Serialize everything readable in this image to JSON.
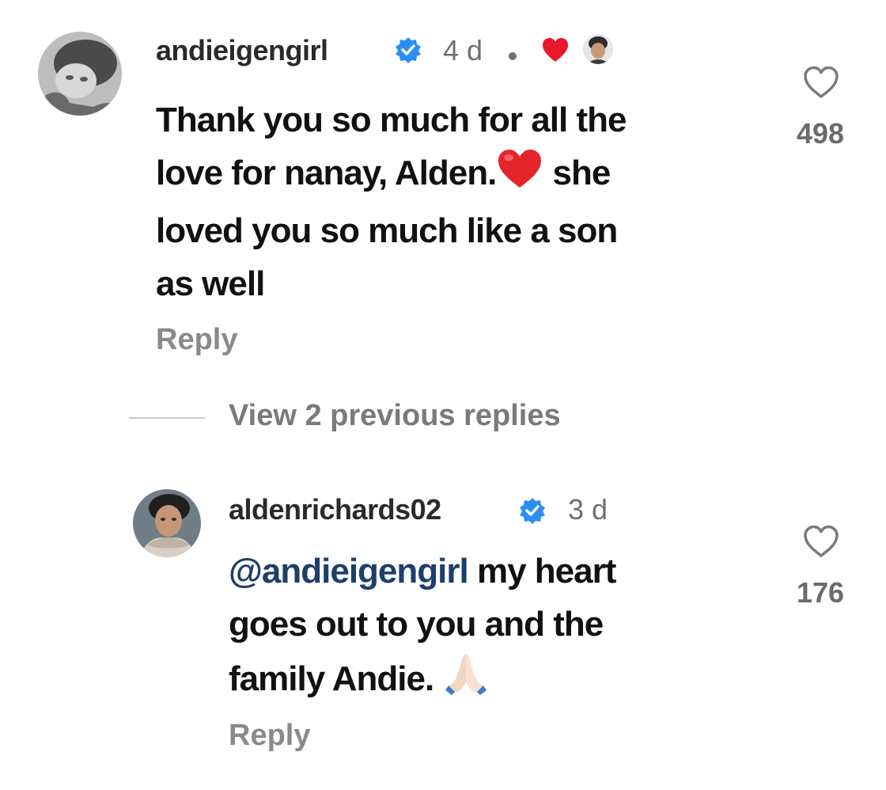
{
  "comments": [
    {
      "username": "andieigengirl",
      "time": "4 d",
      "text_line1": "Thank you so much for all the",
      "text_line2_a": "love for nanay, Alden.",
      "text_line2_b": " she",
      "text_line3": "loved you so much like a son",
      "text_line4": "as well",
      "reply_label": "Reply",
      "likes": "498",
      "liked_by_creator_icon": "red-heart-with-creator-avatar"
    },
    {
      "username": "aldenrichards02",
      "time": "3 d",
      "mention": "@andieigengirl",
      "text_line1_rest": " my heart",
      "text_line2": "goes out to you and the",
      "text_line3": "family Andie.",
      "reply_label": "Reply",
      "likes": "176"
    }
  ],
  "view_previous_replies": "View 2 previous replies",
  "colors": {
    "mention": "#1e3f6b",
    "verified": "#2a8ef5",
    "liked_heart": "#e8182c"
  }
}
